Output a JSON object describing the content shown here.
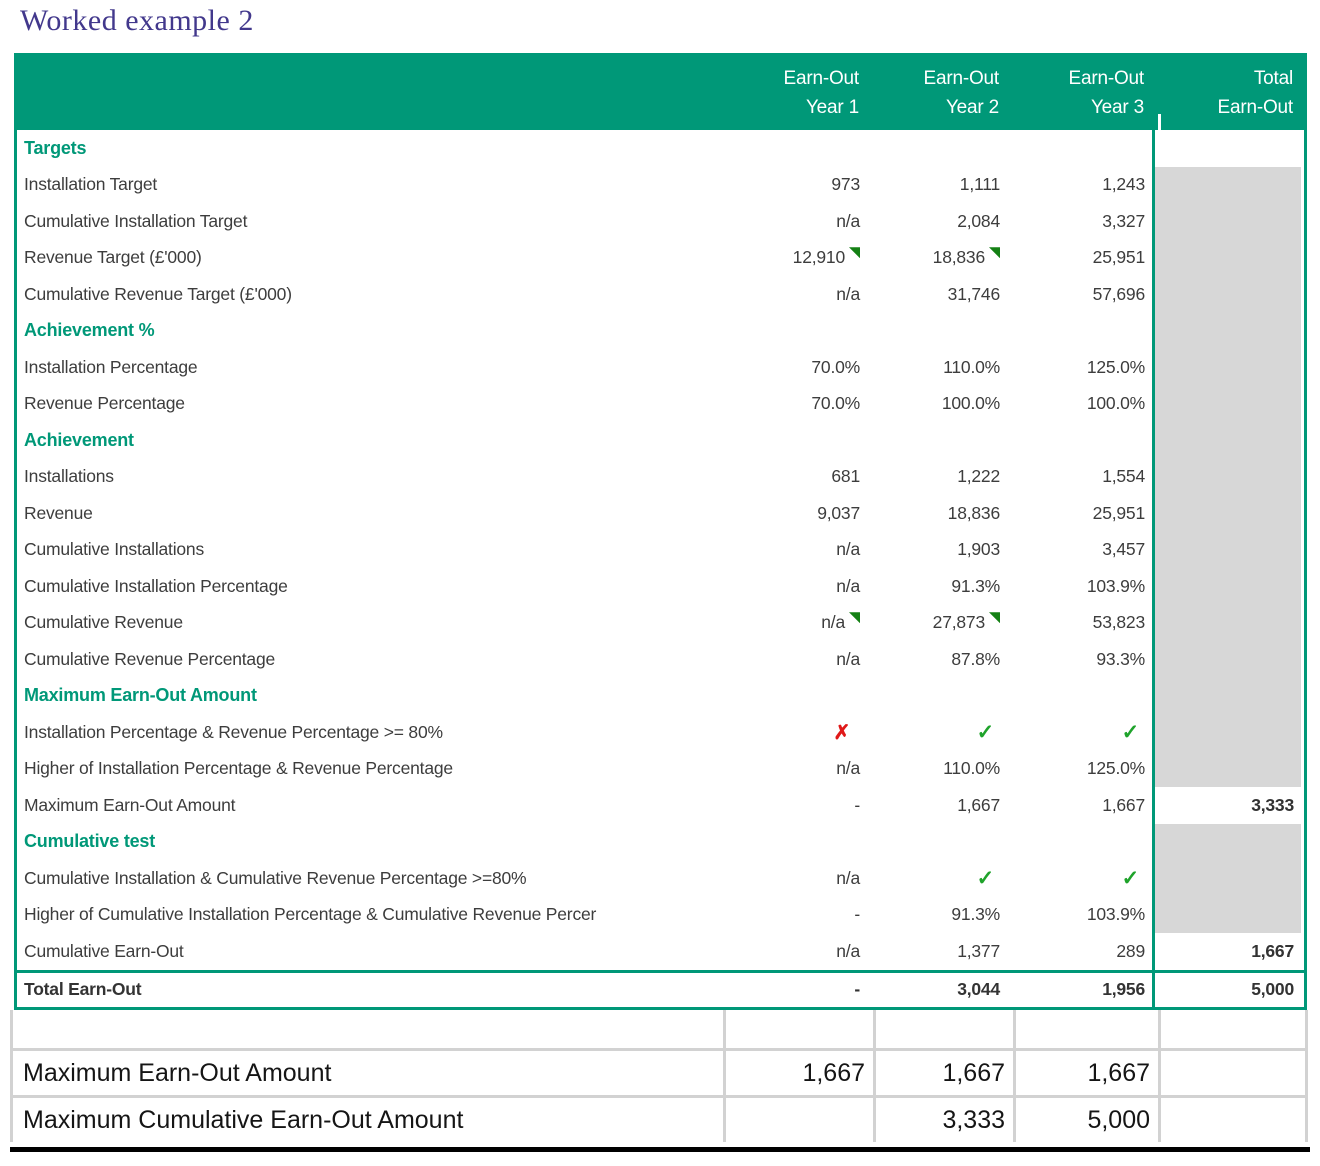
{
  "title": "Worked example 2",
  "colors": {
    "header_green": "#009878",
    "section_green": "#009878",
    "gray_fill": "#d7d7d7",
    "check_green": "#1fa32b",
    "cross_red": "#e01919",
    "flag_green": "#158015",
    "title_purple": "#42388c"
  },
  "icons": {
    "check": "✓",
    "cross": "✗"
  },
  "main_table": {
    "headers": [
      {
        "line1": "Earn-Out",
        "line2": "Year 1"
      },
      {
        "line1": "Earn-Out",
        "line2": "Year 2"
      },
      {
        "line1": "Earn-Out",
        "line2": "Year 3"
      },
      {
        "line1": "Total",
        "line2": "Earn-Out"
      }
    ],
    "rows": [
      {
        "type": "section",
        "label": "Targets",
        "total": {
          "v": "",
          "white": true
        }
      },
      {
        "type": "data",
        "label": "Installation Target",
        "cells": [
          {
            "v": "973"
          },
          {
            "v": "1,111"
          },
          {
            "v": "1,243"
          }
        ]
      },
      {
        "type": "data",
        "label": "Cumulative Installation Target",
        "cells": [
          {
            "v": "n/a"
          },
          {
            "v": "2,084"
          },
          {
            "v": "3,327"
          }
        ]
      },
      {
        "type": "data",
        "label": "Revenue Target (£'000)",
        "cells": [
          {
            "v": "12,910",
            "flag": true
          },
          {
            "v": "18,836",
            "flag": true
          },
          {
            "v": "25,951"
          }
        ]
      },
      {
        "type": "data",
        "label": "Cumulative Revenue Target (£'000)",
        "cells": [
          {
            "v": "n/a"
          },
          {
            "v": "31,746"
          },
          {
            "v": "57,696"
          }
        ]
      },
      {
        "type": "section",
        "label": "Achievement %"
      },
      {
        "type": "data",
        "label": "Installation Percentage",
        "cells": [
          {
            "v": "70.0%"
          },
          {
            "v": "110.0%"
          },
          {
            "v": "125.0%"
          }
        ]
      },
      {
        "type": "data",
        "label": "Revenue Percentage",
        "cells": [
          {
            "v": "70.0%"
          },
          {
            "v": "100.0%"
          },
          {
            "v": "100.0%"
          }
        ]
      },
      {
        "type": "section",
        "label": "Achievement"
      },
      {
        "type": "data",
        "label": "Installations",
        "cells": [
          {
            "v": "681"
          },
          {
            "v": "1,222"
          },
          {
            "v": "1,554"
          }
        ]
      },
      {
        "type": "data",
        "label": "Revenue",
        "cells": [
          {
            "v": "9,037"
          },
          {
            "v": "18,836"
          },
          {
            "v": "25,951"
          }
        ]
      },
      {
        "type": "data",
        "label": "Cumulative Installations",
        "cells": [
          {
            "v": "n/a"
          },
          {
            "v": "1,903"
          },
          {
            "v": "3,457"
          }
        ]
      },
      {
        "type": "data",
        "label": "Cumulative Installation Percentage",
        "cells": [
          {
            "v": "n/a"
          },
          {
            "v": "91.3%"
          },
          {
            "v": "103.9%"
          }
        ]
      },
      {
        "type": "data",
        "label": "Cumulative Revenue",
        "cells": [
          {
            "v": "n/a",
            "flag": true
          },
          {
            "v": "27,873",
            "flag": true
          },
          {
            "v": "53,823"
          }
        ]
      },
      {
        "type": "data",
        "label": "Cumulative Revenue Percentage",
        "cells": [
          {
            "v": "n/a"
          },
          {
            "v": "87.8%"
          },
          {
            "v": "93.3%"
          }
        ]
      },
      {
        "type": "section",
        "label": "Maximum Earn-Out Amount"
      },
      {
        "type": "data",
        "label": "Installation Percentage & Revenue Percentage >= 80%",
        "cells": [
          {
            "icon": "cross"
          },
          {
            "icon": "check"
          },
          {
            "icon": "check"
          }
        ]
      },
      {
        "type": "data",
        "label": "Higher of Installation Percentage & Revenue Percentage",
        "cells": [
          {
            "v": "n/a"
          },
          {
            "v": "110.0%"
          },
          {
            "v": "125.0%"
          }
        ]
      },
      {
        "type": "data",
        "label": "Maximum Earn-Out Amount",
        "cells": [
          {
            "v": "-"
          },
          {
            "v": "1,667"
          },
          {
            "v": "1,667"
          }
        ],
        "total": {
          "v": "3,333",
          "white": true,
          "bold": true
        }
      },
      {
        "type": "section",
        "label": "Cumulative test"
      },
      {
        "type": "data",
        "label": "Cumulative Installation & Cumulative Revenue Percentage >=80%",
        "cells": [
          {
            "v": "n/a"
          },
          {
            "icon": "check"
          },
          {
            "icon": "check"
          }
        ]
      },
      {
        "type": "data",
        "label": "Higher of Cumulative Installation Percentage & Cumulative Revenue Percer",
        "cells": [
          {
            "v": "-"
          },
          {
            "v": "91.3%"
          },
          {
            "v": "103.9%"
          }
        ]
      },
      {
        "type": "data",
        "label": "Cumulative Earn-Out",
        "cells": [
          {
            "v": "n/a"
          },
          {
            "v": "1,377"
          },
          {
            "v": "289"
          }
        ],
        "total": {
          "v": "1,667",
          "white": true,
          "bold": true
        }
      },
      {
        "type": "total",
        "label": "Total Earn-Out",
        "cells": [
          {
            "v": "-",
            "bold": true
          },
          {
            "v": "3,044",
            "bold": true
          },
          {
            "v": "1,956",
            "bold": true
          }
        ],
        "total": {
          "v": "5,000",
          "white": true,
          "bold": true
        }
      }
    ]
  },
  "summary_table": {
    "rows": [
      {
        "label": "",
        "cells": [
          "",
          "",
          "",
          ""
        ],
        "spacer": true
      },
      {
        "label": "Maximum Earn-Out Amount",
        "cells": [
          "1,667",
          "1,667",
          "1,667",
          ""
        ]
      },
      {
        "label": "Maximum Cumulative Earn-Out Amount",
        "cells": [
          "",
          "3,333",
          "5,000",
          ""
        ]
      }
    ]
  }
}
